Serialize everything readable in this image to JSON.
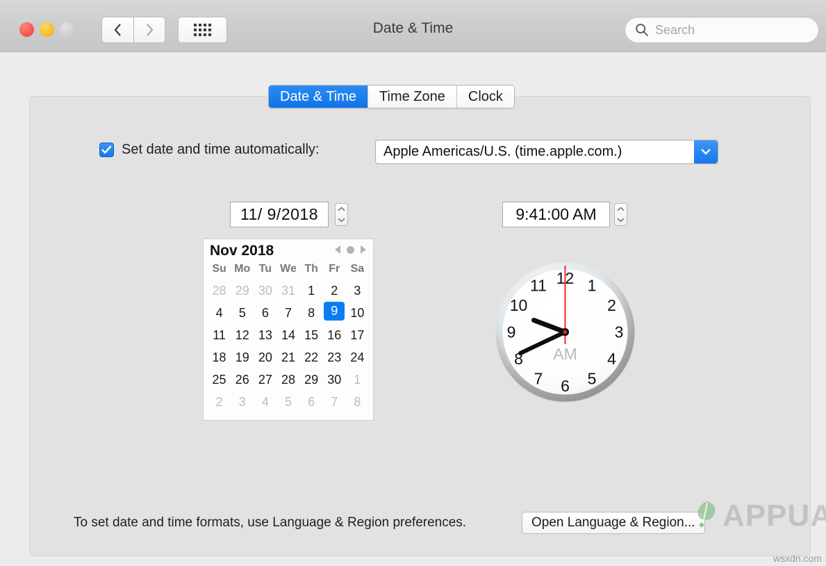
{
  "window": {
    "title": "Date & Time",
    "traffic_lights": [
      {
        "name": "close",
        "color": "#f8564f"
      },
      {
        "name": "minimize",
        "color": "#f7bc2e"
      },
      {
        "name": "zoom",
        "color": "#d2d2d2"
      }
    ],
    "nav": {
      "back_icon": "chevron-left-icon",
      "forward_icon": "chevron-right-icon",
      "grid_icon": "show-all-grid-icon"
    }
  },
  "search": {
    "placeholder": "Search",
    "value": "",
    "icon": "search-icon"
  },
  "tabs": [
    {
      "label": "Date & Time",
      "active": true
    },
    {
      "label": "Time Zone",
      "active": false
    },
    {
      "label": "Clock",
      "active": false
    }
  ],
  "auto_set": {
    "label": "Set date and time automatically:",
    "checked": true,
    "checkbox_color": "#1478ec",
    "server": {
      "selected": "Apple Americas/U.S. (time.apple.com.)",
      "arrow_icon": "chevron-down-icon",
      "arrow_color": "#1478ec"
    }
  },
  "date_field": {
    "value": "11/  9/2018",
    "stepper_icon": "stepper-up-down-icon"
  },
  "time_field": {
    "value": "9:41:00 AM",
    "stepper_icon": "stepper-up-down-icon"
  },
  "calendar": {
    "month_year": "Nov 2018",
    "nav": {
      "prev_icon": "triangle-left-icon",
      "today_icon": "dot-icon",
      "next_icon": "triangle-right-icon"
    },
    "day_headers": [
      "Su",
      "Mo",
      "Tu",
      "We",
      "Th",
      "Fr",
      "Sa"
    ],
    "selected_day": 9,
    "selected_color": "#0a7ef0",
    "weeks": [
      [
        {
          "d": "28",
          "dim": true
        },
        {
          "d": "29",
          "dim": true
        },
        {
          "d": "30",
          "dim": true
        },
        {
          "d": "31",
          "dim": true
        },
        {
          "d": "1",
          "dim": false
        },
        {
          "d": "2",
          "dim": false
        },
        {
          "d": "3",
          "dim": false
        }
      ],
      [
        {
          "d": "4",
          "dim": false
        },
        {
          "d": "5",
          "dim": false
        },
        {
          "d": "6",
          "dim": false
        },
        {
          "d": "7",
          "dim": false
        },
        {
          "d": "8",
          "dim": false
        },
        {
          "d": "9",
          "dim": false,
          "sel": true
        },
        {
          "d": "10",
          "dim": false
        }
      ],
      [
        {
          "d": "11",
          "dim": false
        },
        {
          "d": "12",
          "dim": false
        },
        {
          "d": "13",
          "dim": false
        },
        {
          "d": "14",
          "dim": false
        },
        {
          "d": "15",
          "dim": false
        },
        {
          "d": "16",
          "dim": false
        },
        {
          "d": "17",
          "dim": false
        }
      ],
      [
        {
          "d": "18",
          "dim": false
        },
        {
          "d": "19",
          "dim": false
        },
        {
          "d": "20",
          "dim": false
        },
        {
          "d": "21",
          "dim": false
        },
        {
          "d": "22",
          "dim": false
        },
        {
          "d": "23",
          "dim": false
        },
        {
          "d": "24",
          "dim": false
        }
      ],
      [
        {
          "d": "25",
          "dim": false
        },
        {
          "d": "26",
          "dim": false
        },
        {
          "d": "27",
          "dim": false
        },
        {
          "d": "28",
          "dim": false
        },
        {
          "d": "29",
          "dim": false
        },
        {
          "d": "30",
          "dim": false
        },
        {
          "d": "1",
          "dim": true
        }
      ],
      [
        {
          "d": "2",
          "dim": true
        },
        {
          "d": "3",
          "dim": true
        },
        {
          "d": "4",
          "dim": true
        },
        {
          "d": "5",
          "dim": true
        },
        {
          "d": "6",
          "dim": true
        },
        {
          "d": "7",
          "dim": true
        },
        {
          "d": "8",
          "dim": true
        }
      ]
    ]
  },
  "clock": {
    "meridiem": "AM",
    "hour_numerals": [
      "12",
      "1",
      "2",
      "3",
      "4",
      "5",
      "6",
      "7",
      "8",
      "9",
      "10",
      "11"
    ],
    "hour_hand_angle": 290.5,
    "minute_hand_angle": 246,
    "second_hand_angle": 0,
    "second_hand_color": "#ee2222",
    "hand_color": "#0d0d0d"
  },
  "footer": {
    "text": "To set date and time formats, use Language & Region preferences.",
    "button_label": "Open Language & Region..."
  },
  "watermark": {
    "brand": "APPUALS",
    "site": "wsxdn.com"
  }
}
